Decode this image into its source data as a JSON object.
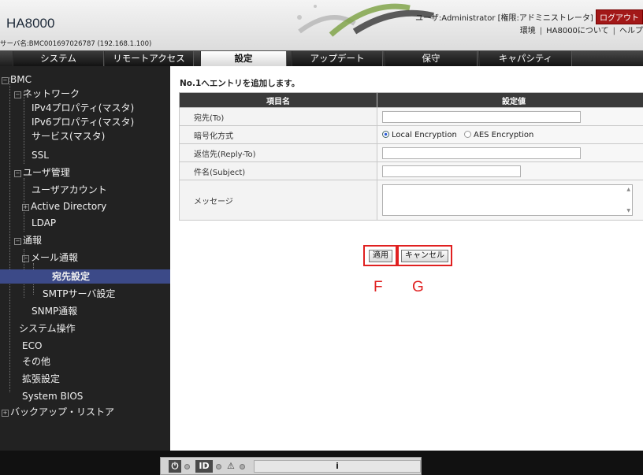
{
  "header": {
    "app_title": "HA8000",
    "server_name": "サーバ名:BMC001697026787 (192.168.1.100)",
    "user_label": "ユーザ:Administrator",
    "role_label": "[権限:アドミニストレータ]",
    "logout": "ログアウト",
    "links": [
      "環境",
      "HA8000について",
      "ヘルプ"
    ]
  },
  "tabs": [
    {
      "label": "システム"
    },
    {
      "label": "リモートアクセス"
    },
    {
      "label": "設定",
      "active": true
    },
    {
      "label": "アップデート"
    },
    {
      "label": "保守"
    },
    {
      "label": "キャパシティ"
    }
  ],
  "sidebar": {
    "items": [
      {
        "label": "BMC"
      },
      {
        "label": "ネットワーク"
      },
      {
        "label": "IPv4プロパティ(マスタ)"
      },
      {
        "label": "IPv6プロパティ(マスタ)"
      },
      {
        "label": "サービス(マスタ)"
      },
      {
        "label": "SSL"
      },
      {
        "label": "ユーザ管理"
      },
      {
        "label": "ユーザアカウント"
      },
      {
        "label": "Active Directory"
      },
      {
        "label": "LDAP"
      },
      {
        "label": "通報"
      },
      {
        "label": "メール通報"
      },
      {
        "label": "宛先設定",
        "selected": true
      },
      {
        "label": "SMTPサーバ設定"
      },
      {
        "label": "SNMP通報"
      },
      {
        "label": "システム操作"
      },
      {
        "label": "ECO"
      },
      {
        "label": "その他"
      },
      {
        "label": "拡張設定"
      },
      {
        "label": "System BIOS"
      },
      {
        "label": "バックアップ・リストア"
      }
    ]
  },
  "form": {
    "title": "No.1へエントリを追加します。",
    "col_item": "項目名",
    "col_value": "設定値",
    "rows": {
      "to": {
        "label": "宛先(To)",
        "value": ""
      },
      "encryption": {
        "label": "暗号化方式",
        "options": [
          "Local Encryption",
          "AES Encryption"
        ],
        "selected": "Local Encryption"
      },
      "reply_to": {
        "label": "返信先(Reply-To)",
        "value": ""
      },
      "subject": {
        "label": "件名(Subject)",
        "value": ""
      },
      "message": {
        "label": "メッセージ",
        "value": ""
      }
    }
  },
  "buttons": {
    "apply": "適用",
    "cancel": "キャンセル"
  },
  "annotations": {
    "f": "F",
    "g": "G"
  },
  "colors": {
    "highlight": "#e02020",
    "selected_nav": "#3c4a88"
  },
  "footer": {
    "id_label": "ID",
    "status_text": "i"
  }
}
